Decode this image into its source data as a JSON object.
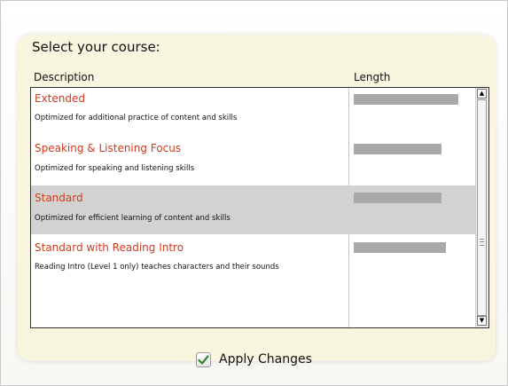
{
  "header": {
    "title": "Select your course:",
    "columns": {
      "description": "Description",
      "length": "Length"
    }
  },
  "courses": [
    {
      "name": "Extended",
      "description": "Optimized for additional practice of content and skills",
      "length_fraction": 1.0,
      "selected": false
    },
    {
      "name": "Speaking & Listening Focus",
      "description": "Optimized for speaking and listening skills",
      "length_fraction": 0.84,
      "selected": false
    },
    {
      "name": "Standard",
      "description": "Optimized for efficient learning of content and skills",
      "length_fraction": 0.84,
      "selected": true
    },
    {
      "name": "Standard with Reading Intro",
      "description": "Reading Intro (Level 1 only) teaches characters and their sounds",
      "length_fraction": 0.88,
      "selected": false
    }
  ],
  "footer": {
    "apply_label": "Apply Changes"
  },
  "colors": {
    "course_name": "#d23a1e",
    "selected_row": "#d2d2d2",
    "length_bar": "#a9a9a9",
    "panel": "#f8f6df",
    "check_mark": "#2f8a2f"
  }
}
